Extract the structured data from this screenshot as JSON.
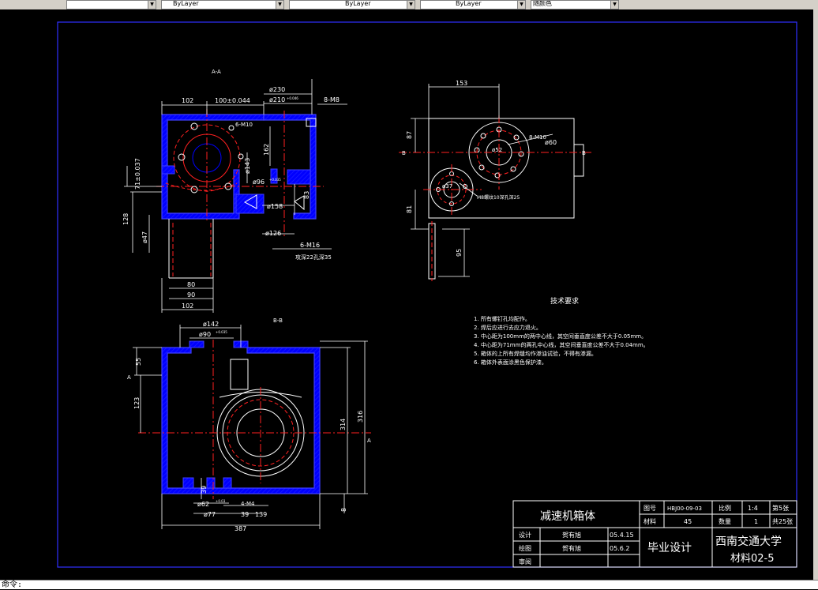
{
  "toolbar": {
    "combos": [
      "ByLayer",
      "ByLayer",
      "ByLayer",
      "随颜色"
    ]
  },
  "command_line": {
    "text": "命令:"
  },
  "drawing": {
    "section_aa": "A-A",
    "section_bb": "B-B",
    "section_marker_a": "A",
    "section_marker_b": "B",
    "dims_aa": {
      "d230": "ø230",
      "d210": "ø210",
      "tol210": "+0.046",
      "m8": "8-M8",
      "w102_top": "102",
      "w100": "100±0.044",
      "m10": "6-M10",
      "h162": "162",
      "d143": "ø143",
      "d96": "ø96",
      "tol96": "+0.035",
      "h71": "71±0.037",
      "d158": "ø158",
      "h83": "83",
      "h128": "128",
      "d47": "ø47",
      "d126": "ø126",
      "m16": "6-M16",
      "m16_note": "攻深22孔深35",
      "w80": "80",
      "w90": "90",
      "w102_bot": "102"
    },
    "dims_side": {
      "w153": "153",
      "h87": "87",
      "h81": "81",
      "h95": "95",
      "m10": "8-M10",
      "d60": "ø60",
      "d52": "ø52",
      "d37": "ø37",
      "m8_note": "M8螺纹10深孔深25"
    },
    "dims_bb": {
      "d142": "ø142",
      "d90": "ø90",
      "tol90": "+0.035",
      "h55": "55",
      "h123": "123",
      "h314": "314",
      "h316": "316",
      "h39": "39",
      "d62": "ø62",
      "tol62": "+0.03",
      "m4": "4-M4",
      "d77": "ø77",
      "w39": "39",
      "w139": "139",
      "w387": "387",
      "h8": "8"
    },
    "tech": {
      "title": "技术要求",
      "items": [
        "1. 所有螺钉孔均配作。",
        "2. 焊后应进行去应力退火。",
        "3. 中心距为100mm的两中心线，其空间垂直度公差不大于0.05mm。",
        "4. 中心距为71mm的两孔中心线，其空间垂直度公差不大于0.04mm。",
        "5. 箱体的上所有焊缝均作渗油试验，不得有渗漏。",
        "6. 箱体外表面涂黑色保护漆。"
      ]
    }
  },
  "title_block": {
    "part_name": "减速机箱体",
    "drawing_no_label": "图号",
    "drawing_no": "HBJ00-09-03",
    "scale_label": "比例",
    "scale": "1:4",
    "sheet": "第5张",
    "material_label": "材料",
    "material": "45",
    "qty_label": "数量",
    "qty": "1",
    "total": "共25张",
    "design_label": "设计",
    "designer": "贺有旭",
    "design_date": "05.4.15",
    "draw_label": "绘图",
    "drafter": "贺有旭",
    "draw_date": "05.6.2",
    "review_label": "审阅",
    "project": "毕业设计",
    "school": "西南交通大学",
    "class": "材料02-5"
  }
}
